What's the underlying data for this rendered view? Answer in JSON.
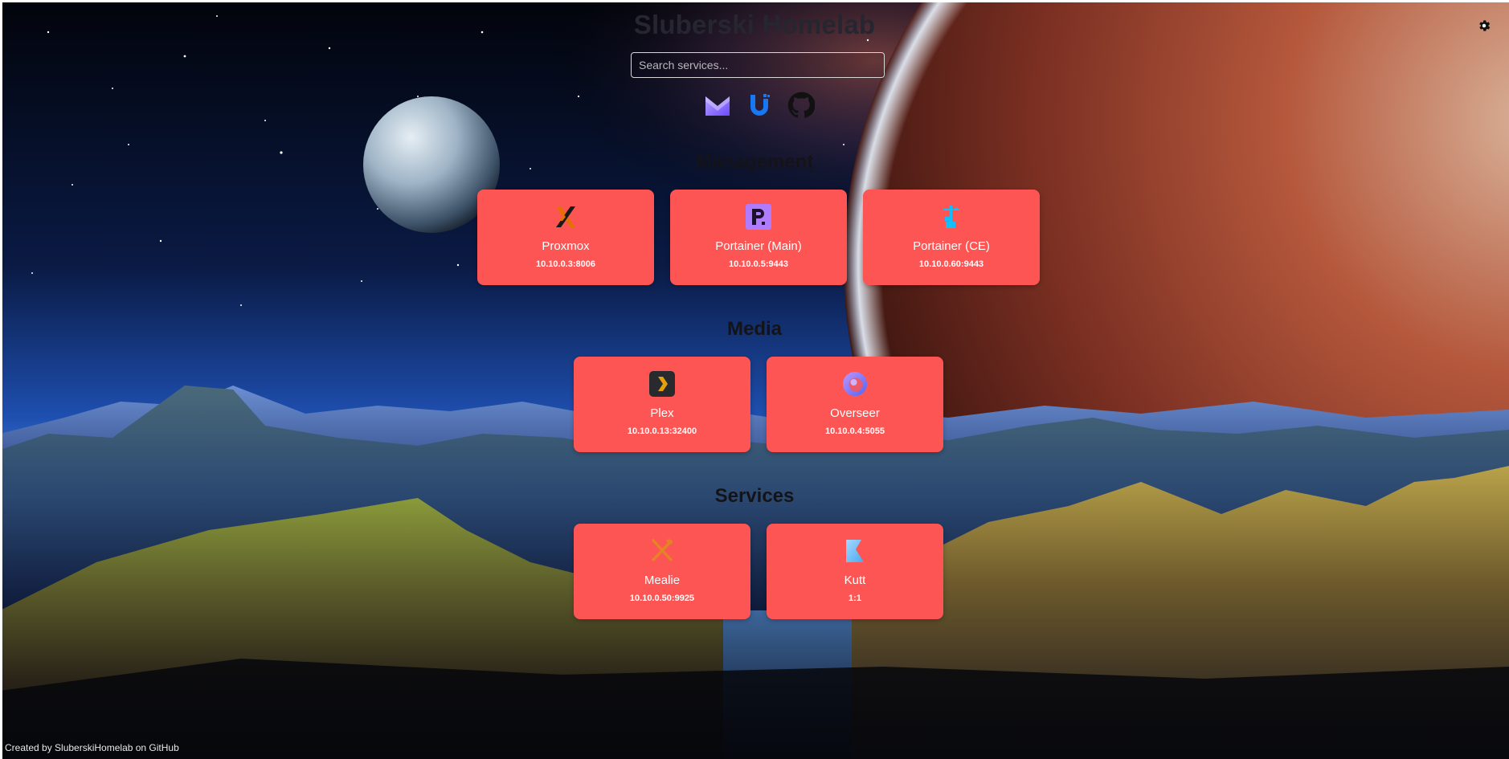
{
  "header": {
    "title": "Sluberski Homelab",
    "search_placeholder": "Search services..."
  },
  "quick_links": [
    {
      "name": "Mail",
      "icon": "mail-m-icon"
    },
    {
      "name": "UniFi",
      "icon": "unifi-u-icon"
    },
    {
      "name": "GitHub",
      "icon": "github-icon"
    }
  ],
  "settings_icon": "gear-icon",
  "sections": [
    {
      "title": "Management",
      "services": [
        {
          "name": "Proxmox",
          "address": "10.10.0.3:8006",
          "icon": "proxmox-icon"
        },
        {
          "name": "Portainer (Main)",
          "address": "10.10.0.5:9443",
          "icon": "portainer-p-icon"
        },
        {
          "name": "Portainer (CE)",
          "address": "10.10.0.60:9443",
          "icon": "portainer-crane-icon"
        }
      ]
    },
    {
      "title": "Media",
      "services": [
        {
          "name": "Plex",
          "address": "10.10.0.13:32400",
          "icon": "plex-icon"
        },
        {
          "name": "Overseer",
          "address": "10.10.0.4:5055",
          "icon": "overseerr-icon"
        }
      ]
    },
    {
      "title": "Services",
      "services": [
        {
          "name": "Mealie",
          "address": "10.10.0.50:9925",
          "icon": "mealie-icon"
        },
        {
          "name": "Kutt",
          "address": "1:1",
          "icon": "kutt-icon"
        }
      ]
    }
  ],
  "footer": {
    "text": "Created by SluberskiHomelab on GitHub"
  },
  "colors": {
    "card": "#fd5554",
    "card_text": "#ffffff",
    "title_text": "#262630",
    "section_title_text": "#141418"
  }
}
